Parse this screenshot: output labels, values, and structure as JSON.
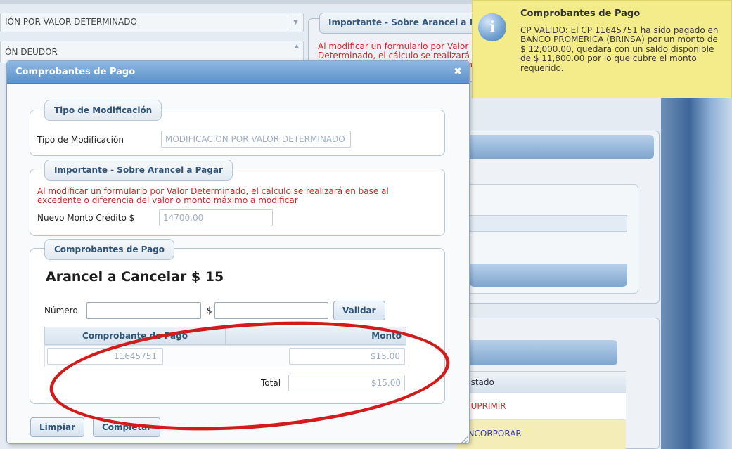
{
  "background": {
    "select_tipo": "IÓN POR VALOR DETERMINADO",
    "select_deudor": "ÓN DEUDOR",
    "importante_legend": "Importante - Sobre Arancel a Pagar",
    "importante_text": "Al modificar un formulario por Valor Determinado, el cálculo se realizará en base al excedente o diferencia del valor o monto máximo a modificar",
    "estado_header": "Estado",
    "row_suprimir": "SUPRIMIR",
    "row_incorporar": "INCORPORAR"
  },
  "notification": {
    "icon": "info-icon",
    "title": "Comprobantes de Pago",
    "body": "CP VALIDO: El CP 11645751 ha sido pagado en BANCO PROMERICA (BRINSA) por un monto de $ 12,000.00, quedara con un saldo disponible de $ 11,800.00 por lo que cubre el monto requerido."
  },
  "dialog": {
    "title": "Comprobantes de Pago",
    "close_icon": "close-icon",
    "tipo_mod": {
      "legend": "Tipo de Modificación",
      "label": "Tipo de Modificación",
      "value": "MODIFICACION POR VALOR DETERMINADO"
    },
    "importante": {
      "legend": "Importante - Sobre Arancel a Pagar",
      "warning": "Al modificar un formulario por Valor Determinado, el cálculo se realizará en base al excedente o diferencia del valor o monto máximo a modificar",
      "credito_label": "Nuevo Monto Crédito $",
      "credito_value": "14700.00"
    },
    "comprobantes": {
      "legend": "Comprobantes de Pago",
      "arancel_text": "Arancel a Cancelar $ 15",
      "numero_label": "Número",
      "numero_value": "",
      "monto_label": "$",
      "monto_value": "",
      "validar_label": "Validar",
      "grid_headers": [
        "Comprobante de Pago",
        "Monto"
      ],
      "rows": [
        {
          "comprobante": "11645751",
          "monto": "$15.00"
        }
      ],
      "total_label": "Total",
      "total_value": "$15.00"
    },
    "buttons": {
      "limpiar": "Limpiar",
      "completar": "Completar"
    }
  },
  "annotation": {
    "color": "#d21c1c",
    "shape": "ellipse"
  }
}
